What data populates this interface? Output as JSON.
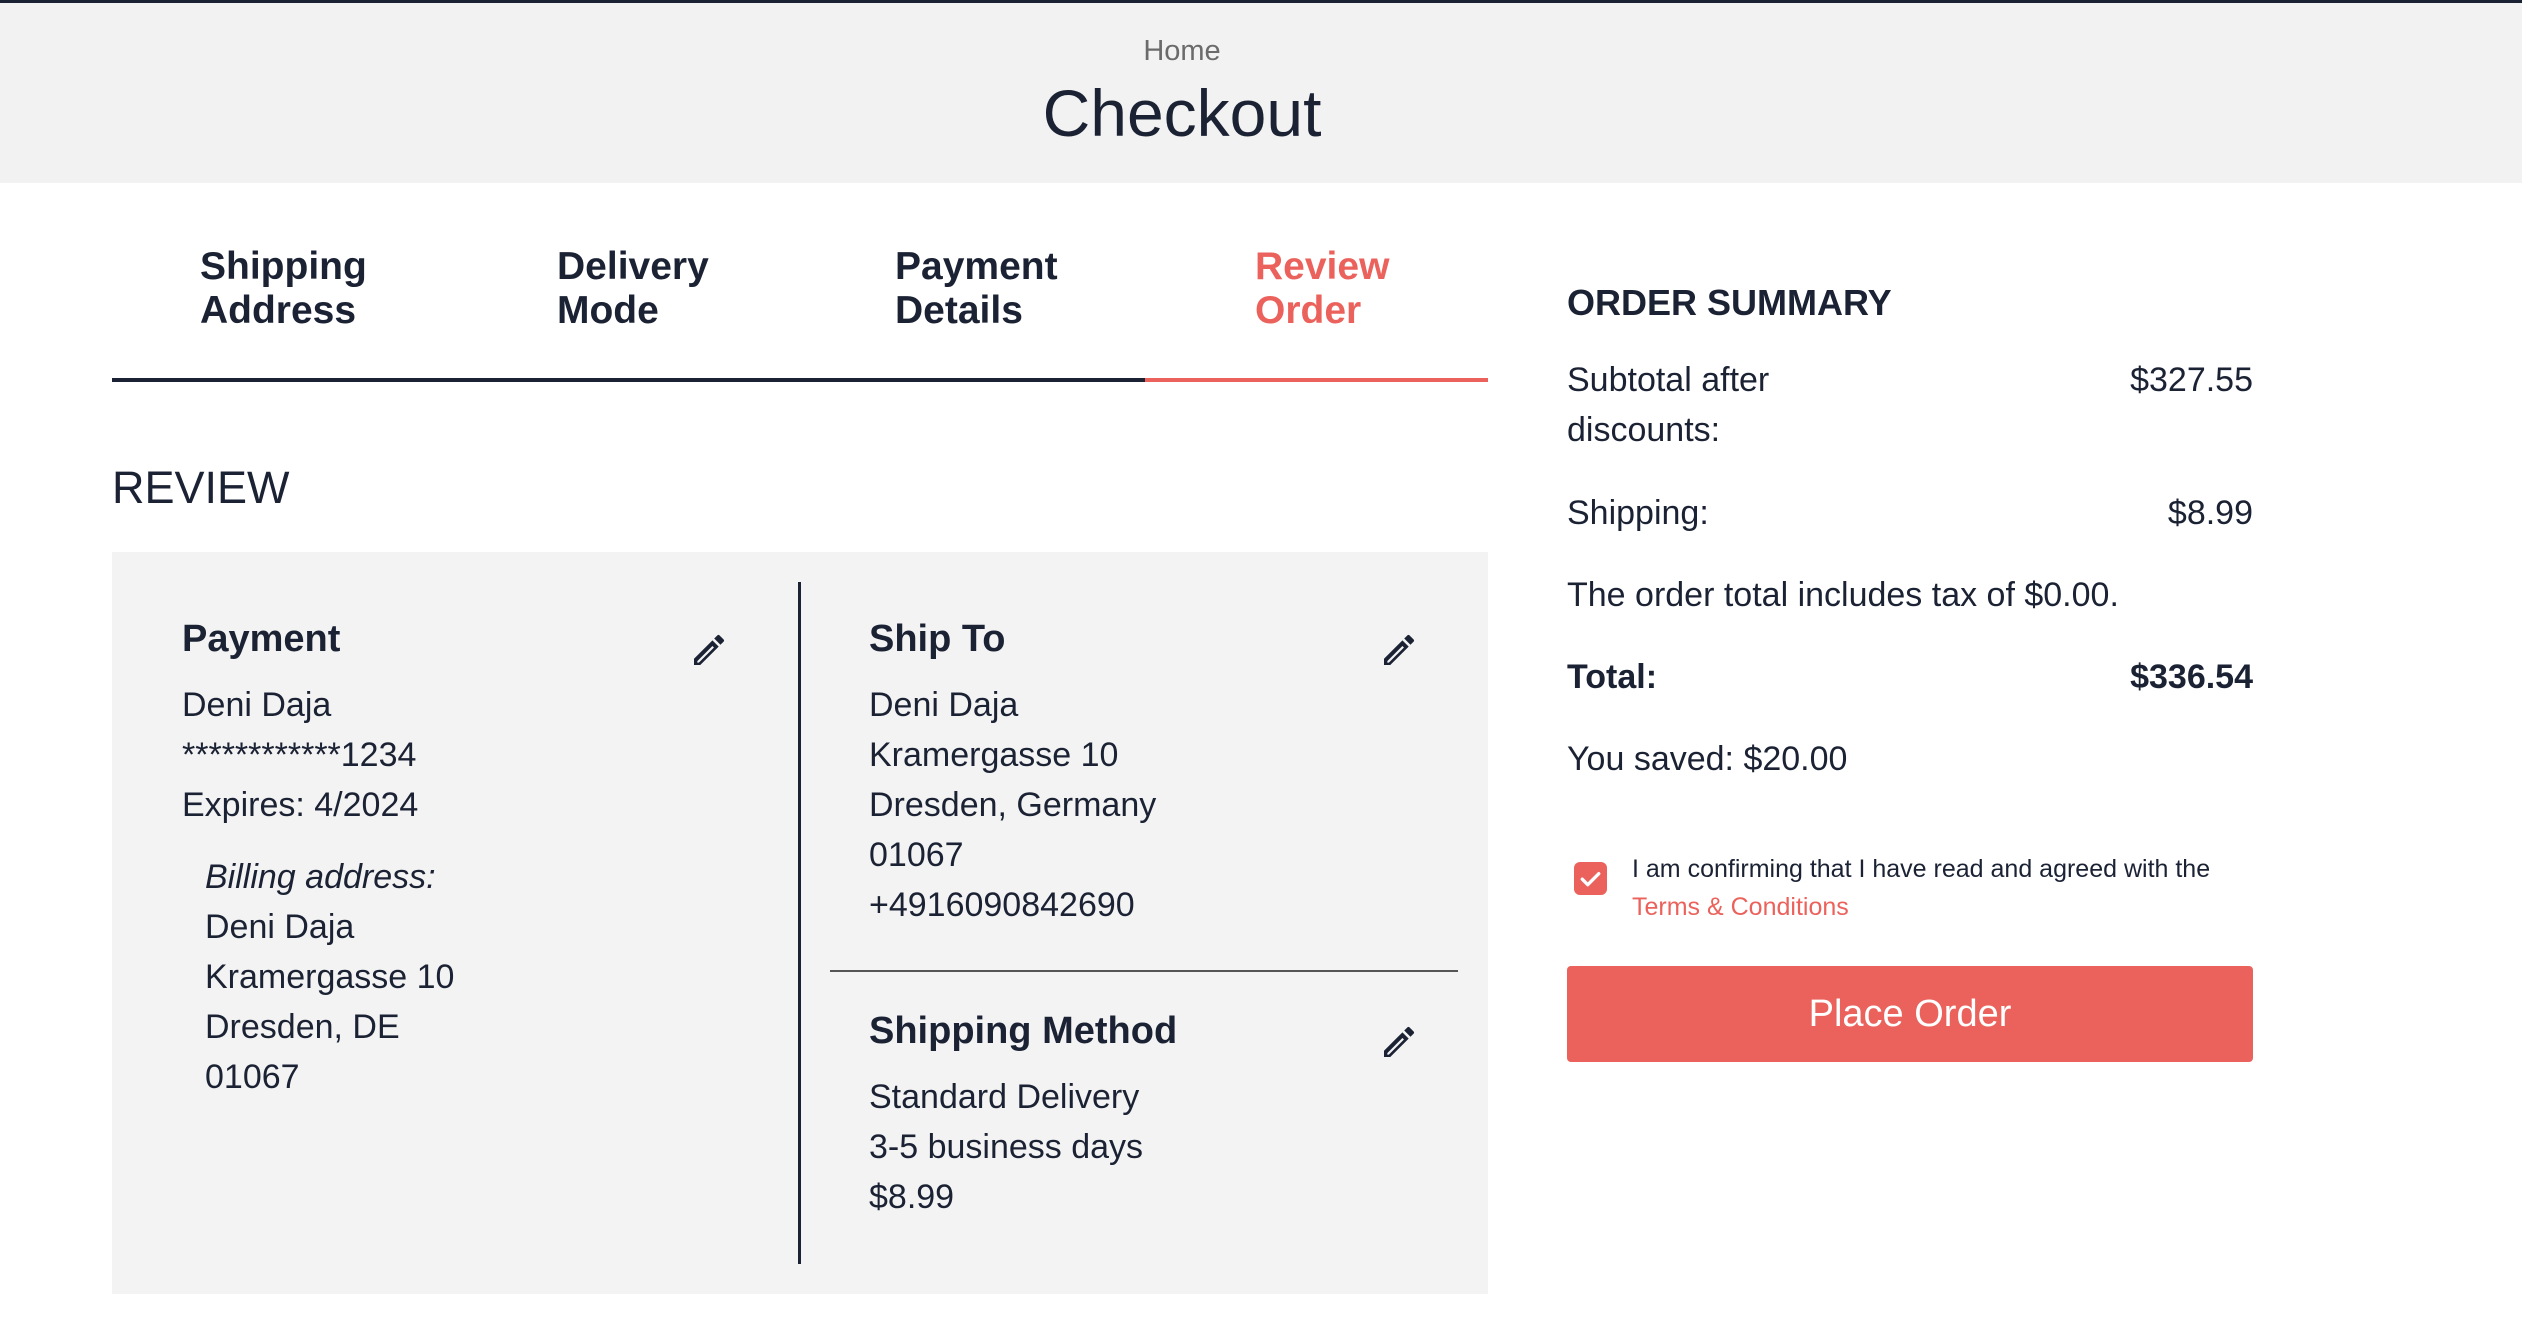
{
  "header": {
    "breadcrumb": "Home",
    "title": "Checkout"
  },
  "steps": [
    {
      "label": "Shipping\nAddress",
      "active": false
    },
    {
      "label": "Delivery\nMode",
      "active": false
    },
    {
      "label": "Payment\nDetails",
      "active": false
    },
    {
      "label": "Review\nOrder",
      "active": true
    }
  ],
  "review": {
    "title": "REVIEW",
    "payment": {
      "title": "Payment",
      "name": "Deni Daja",
      "card": "************1234",
      "expires": "Expires: 4/2024",
      "billing_label": "Billing address:",
      "billing_name": "Deni Daja",
      "billing_street": "Kramergasse 10",
      "billing_city": "Dresden, DE",
      "billing_zip": "01067"
    },
    "ship_to": {
      "title": "Ship To",
      "name": "Deni Daja",
      "street": "Kramergasse 10",
      "city": "Dresden, Germany",
      "zip": "01067",
      "phone": "+4916090842690"
    },
    "shipping_method": {
      "title": "Shipping Method",
      "name": "Standard Delivery",
      "duration": "3-5 business days",
      "price": "$8.99"
    },
    "edit_icon": "pencil-icon"
  },
  "summary": {
    "title": "ORDER SUMMARY",
    "subtotal_label": "Subtotal after\ndiscounts:",
    "subtotal_value": "$327.55",
    "shipping_label": "Shipping:",
    "shipping_value": "$8.99",
    "tax_note": "The order total includes tax of $0.00.",
    "total_label": "Total:",
    "total_value": "$336.54",
    "saved": "You saved: $20.00",
    "confirm_text": "I am confirming that I have read and agreed with the",
    "terms_link": "Terms & Conditions",
    "terms_checked": true,
    "place_order": "Place Order"
  },
  "colors": {
    "accent": "#eb625c",
    "text": "#1b2234",
    "panel": "#f3f3f3",
    "header_bg": "#f2f2f2"
  }
}
